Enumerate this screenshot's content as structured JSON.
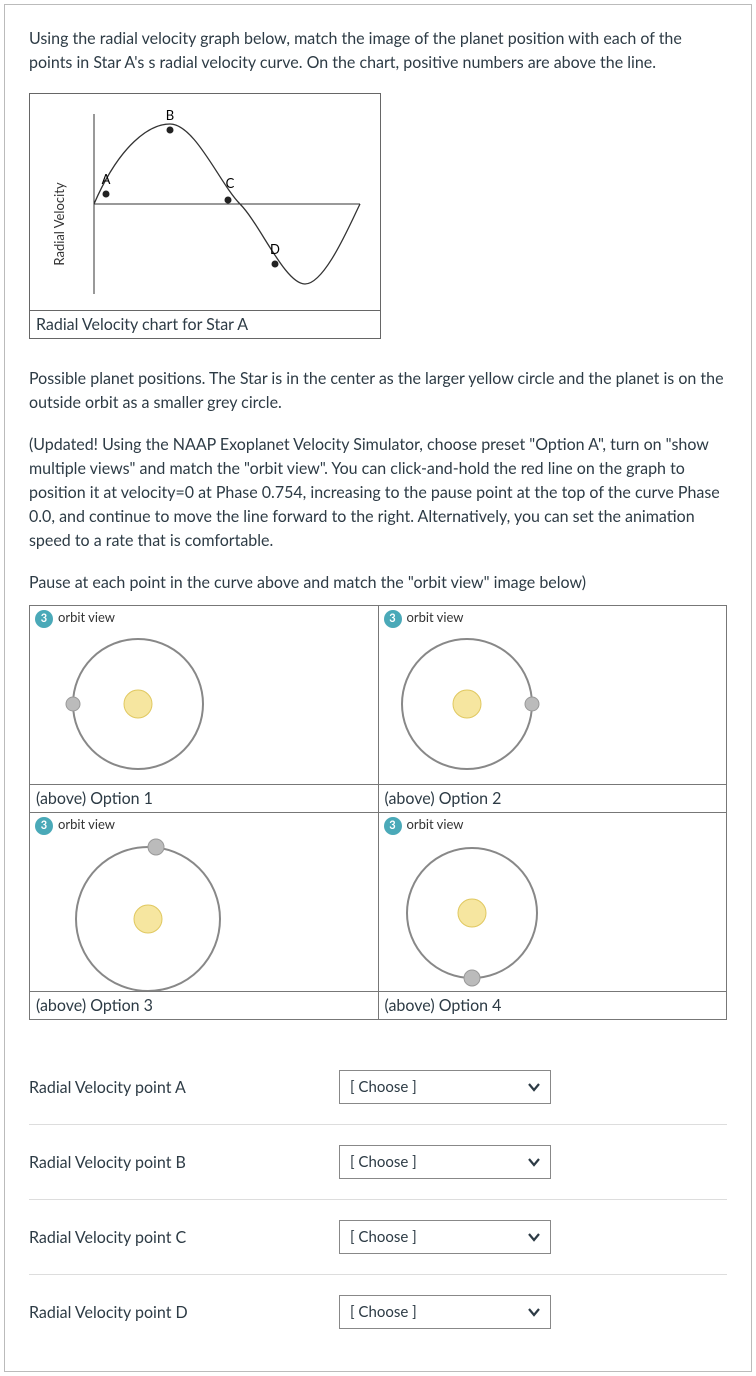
{
  "intro": "Using the radial velocity graph below, match the image of the planet position with each of the points in Star A's s radial velocity curve.   On the chart, positive numbers are above the line.",
  "chart": {
    "caption": "Radial Velocity chart for Star A",
    "ylabel": "Radial Velocity",
    "points": {
      "A": "A",
      "B": "B",
      "C": "C",
      "D": "D"
    }
  },
  "positions_intro": "Possible planet positions.  The Star is in the center as the larger yellow circle and the planet is on the outside orbit as a smaller grey circle.",
  "updated_note": "(Updated!  Using the NAAP Exoplanet Velocity Simulator, choose preset \"Option A\", turn on \"show multiple views\" and match the \"orbit view\".  You can click-and-hold the red line on the graph to position it at velocity=0 at Phase 0.754, increasing to the pause point at the top of the curve Phase 0.0, and continue to move the line forward to the right.  Alternatively, you can set the animation speed to a rate that is comfortable.",
  "pause_note": "Pause at each point in the curve above and match the \"orbit view\" image below)",
  "orbit": {
    "badge": "3",
    "title": "orbit view",
    "options": [
      {
        "caption": "(above) Option 1",
        "planet_angle_deg": 180
      },
      {
        "caption": "(above) Option 2",
        "planet_angle_deg": 0
      },
      {
        "caption": "(above) Option 3",
        "planet_angle_deg": 95
      },
      {
        "caption": "(above) Option 4",
        "planet_angle_deg": 270
      }
    ]
  },
  "match": {
    "rows": [
      {
        "label": "Radial Velocity point A"
      },
      {
        "label": "Radial Velocity point B"
      },
      {
        "label": "Radial Velocity point C"
      },
      {
        "label": "Radial Velocity point D"
      }
    ],
    "placeholder": "[ Choose ]"
  },
  "chart_data": {
    "type": "line",
    "title": "Radial Velocity chart for Star A",
    "xlabel": "",
    "ylabel": "Radial Velocity",
    "description": "Single-cycle sine-like curve with points A (zero crossing rising), B (positive peak), C (zero crossing falling), D (negative trough). Positive values are above the horizontal axis.",
    "labeled_points": [
      {
        "name": "A",
        "phase": 0.0,
        "rv": 0
      },
      {
        "name": "B",
        "phase": 0.25,
        "rv": 1
      },
      {
        "name": "C",
        "phase": 0.5,
        "rv": 0
      },
      {
        "name": "D",
        "phase": 0.75,
        "rv": -1
      }
    ],
    "ylim": [
      -1,
      1
    ]
  }
}
